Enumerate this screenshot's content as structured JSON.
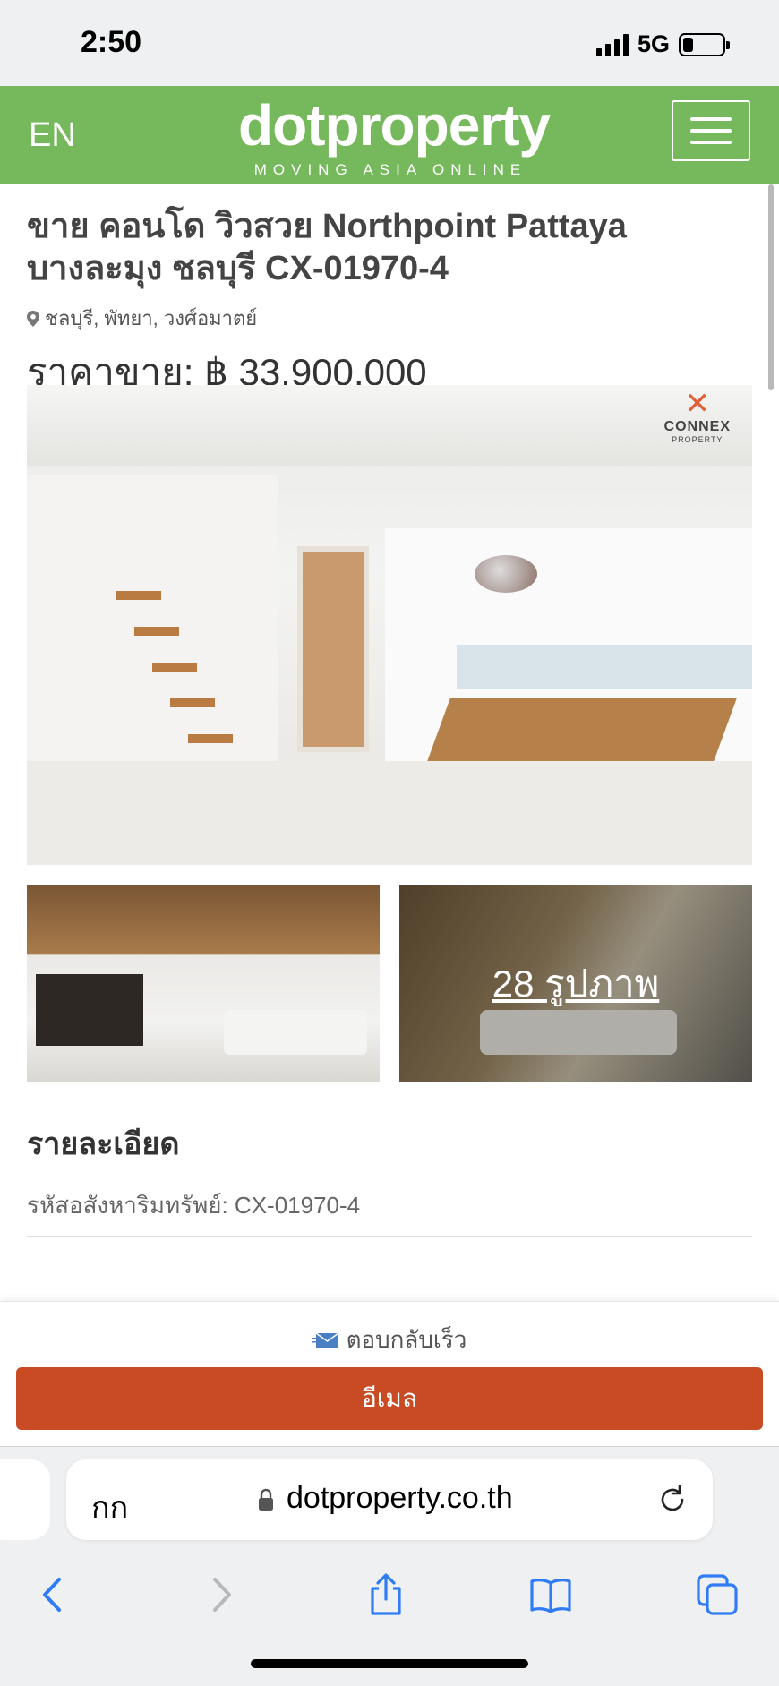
{
  "status_bar": {
    "time": "2:50",
    "network": "5G",
    "battery_level": 0.25
  },
  "header": {
    "language": "EN",
    "logo_text": "dotproperty",
    "logo_tagline": "MOVING ASIA ONLINE",
    "brand_color": "#76b85c"
  },
  "listing": {
    "title": "ขาย คอนโด วิวสวย Northpoint Pattaya บางละมุง ชลบุรี CX-01970-4",
    "location": "ชลบุรี, พัทยา, วงศ์อมาตย์",
    "price_label": "ราคาขาย: ฿ 33,900,000",
    "watermark_name": "CONNEX",
    "watermark_sub": "PROPERTY",
    "photo_count_label": "28 รูปภาพ"
  },
  "details": {
    "heading": "รายละเอียด",
    "reference": "รหัสอสังหาริมทรัพย์: CX-01970-4"
  },
  "contact": {
    "quick_reply": "ตอบกลับเร็ว",
    "email_button": "อีเมล",
    "button_color": "#c84b24"
  },
  "browser": {
    "aa_label": "กก",
    "url": "dotproperty.co.th"
  }
}
